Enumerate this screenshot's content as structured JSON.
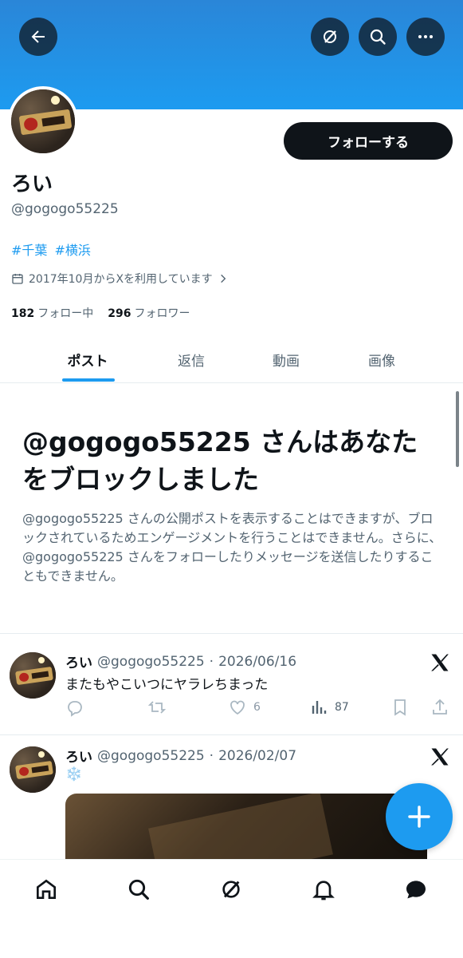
{
  "profile": {
    "name": "ろい",
    "handle": "@gogogo55225",
    "tags": [
      "#千葉",
      "#横浜"
    ],
    "joined": "2017年10月からXを利用しています",
    "following_count": "182",
    "following_label": "フォロー中",
    "followers_count": "296",
    "followers_label": "フォロワー",
    "follow_button": "フォローする"
  },
  "tabs": [
    {
      "label": "ポスト",
      "active": true
    },
    {
      "label": "返信",
      "active": false
    },
    {
      "label": "動画",
      "active": false
    },
    {
      "label": "画像",
      "active": false
    }
  ],
  "blocked": {
    "title": "@gogogo55225 さんはあなたをブロックしました",
    "description": "@gogogo55225 さんの公開ポストを表示することはできますが、ブロックされているためエンゲージメントを行うことはできません。さらに、@gogogo55225 さんをフォローしたりメッセージを送信したりすることもできません。"
  },
  "posts": [
    {
      "name": "ろい",
      "handle": "@gogogo55225",
      "date": "2026/06/16",
      "text": "またもやこいつにヤラレちまった",
      "likes": "6",
      "views": "87"
    },
    {
      "name": "ろい",
      "handle": "@gogogo55225",
      "date": "2026/02/07",
      "text": "❄️"
    }
  ],
  "separator": "·",
  "colors": {
    "banner": "#1d9bf0",
    "accent": "#1d9bf0",
    "text": "#0f1419",
    "secondary": "#536471"
  },
  "icons": [
    "back-arrow-icon",
    "grok-icon",
    "search-icon",
    "more-icon",
    "calendar-icon",
    "chevron-right-icon",
    "reply-icon",
    "repost-icon",
    "like-icon",
    "views-icon",
    "bookmark-icon",
    "share-icon",
    "x-logo-icon",
    "compose-plus-icon",
    "home-icon",
    "messages-icon",
    "notifications-icon"
  ]
}
